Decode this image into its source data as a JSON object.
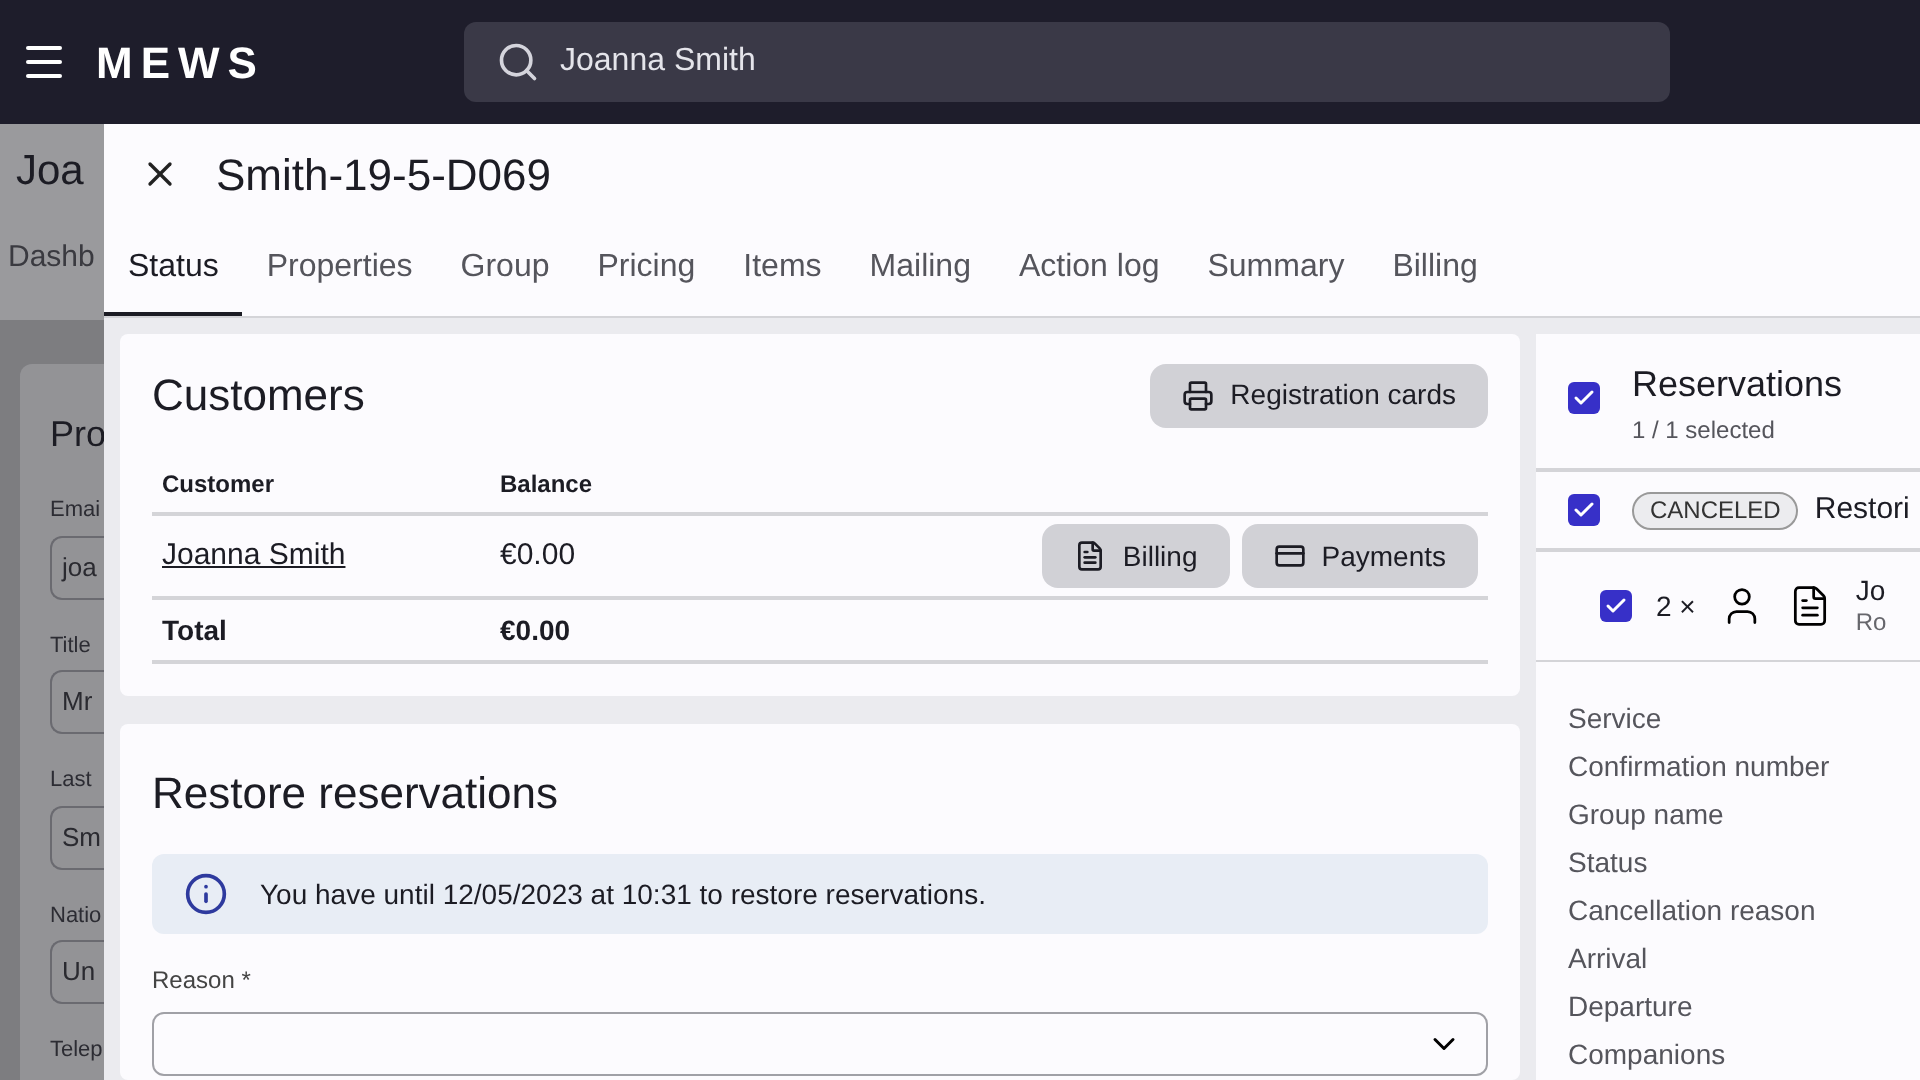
{
  "top_bar": {
    "logo": "MEWS",
    "search": {
      "value": "Joanna Smith"
    }
  },
  "background_page": {
    "title": "Joa",
    "tab": "Dashb",
    "card_title": "Pro",
    "fields": [
      {
        "label": "Emai",
        "value": "joa"
      },
      {
        "label": "Title",
        "value": "Mr"
      },
      {
        "label": "Last",
        "value": "Sm"
      },
      {
        "label": "Natio",
        "value": "Un"
      },
      {
        "label": "Telep"
      }
    ]
  },
  "drawer": {
    "title": "Smith-19-5-D069",
    "tabs": [
      {
        "label": "Status",
        "selected": true
      },
      {
        "label": "Properties",
        "selected": false
      },
      {
        "label": "Group",
        "selected": false
      },
      {
        "label": "Pricing",
        "selected": false
      },
      {
        "label": "Items",
        "selected": false
      },
      {
        "label": "Mailing",
        "selected": false
      },
      {
        "label": "Action log",
        "selected": false
      },
      {
        "label": "Summary",
        "selected": false
      },
      {
        "label": "Billing",
        "selected": false
      }
    ],
    "customers": {
      "title": "Customers",
      "action": "Registration cards",
      "columns": [
        "Customer",
        "Balance"
      ],
      "rows": [
        {
          "customer": "Joanna Smith",
          "balance": "€0.00",
          "buttons": [
            {
              "kind": "billing",
              "label": "Billing"
            },
            {
              "kind": "payments",
              "label": "Payments"
            }
          ]
        }
      ],
      "total": {
        "label": "Total",
        "balance": "€0.00"
      }
    },
    "restore": {
      "title": "Restore reservations",
      "notice": "You have until 12/05/2023 at 10:31 to restore reservations.",
      "reason": {
        "label": "Reason *"
      }
    },
    "reservations": {
      "title": "Reservations",
      "selected_count": "1 / 1 selected",
      "checked": true,
      "group": {
        "checked": true,
        "badge": "CANCELED",
        "text": "Restori"
      },
      "item": {
        "checked": true,
        "count": "2 ×",
        "name": "Jo",
        "sub": "Ro"
      },
      "details": [
        "Service",
        "Confirmation number",
        "Group name",
        "Status",
        "Cancellation reason",
        "Arrival",
        "Departure",
        "Companions"
      ]
    }
  }
}
